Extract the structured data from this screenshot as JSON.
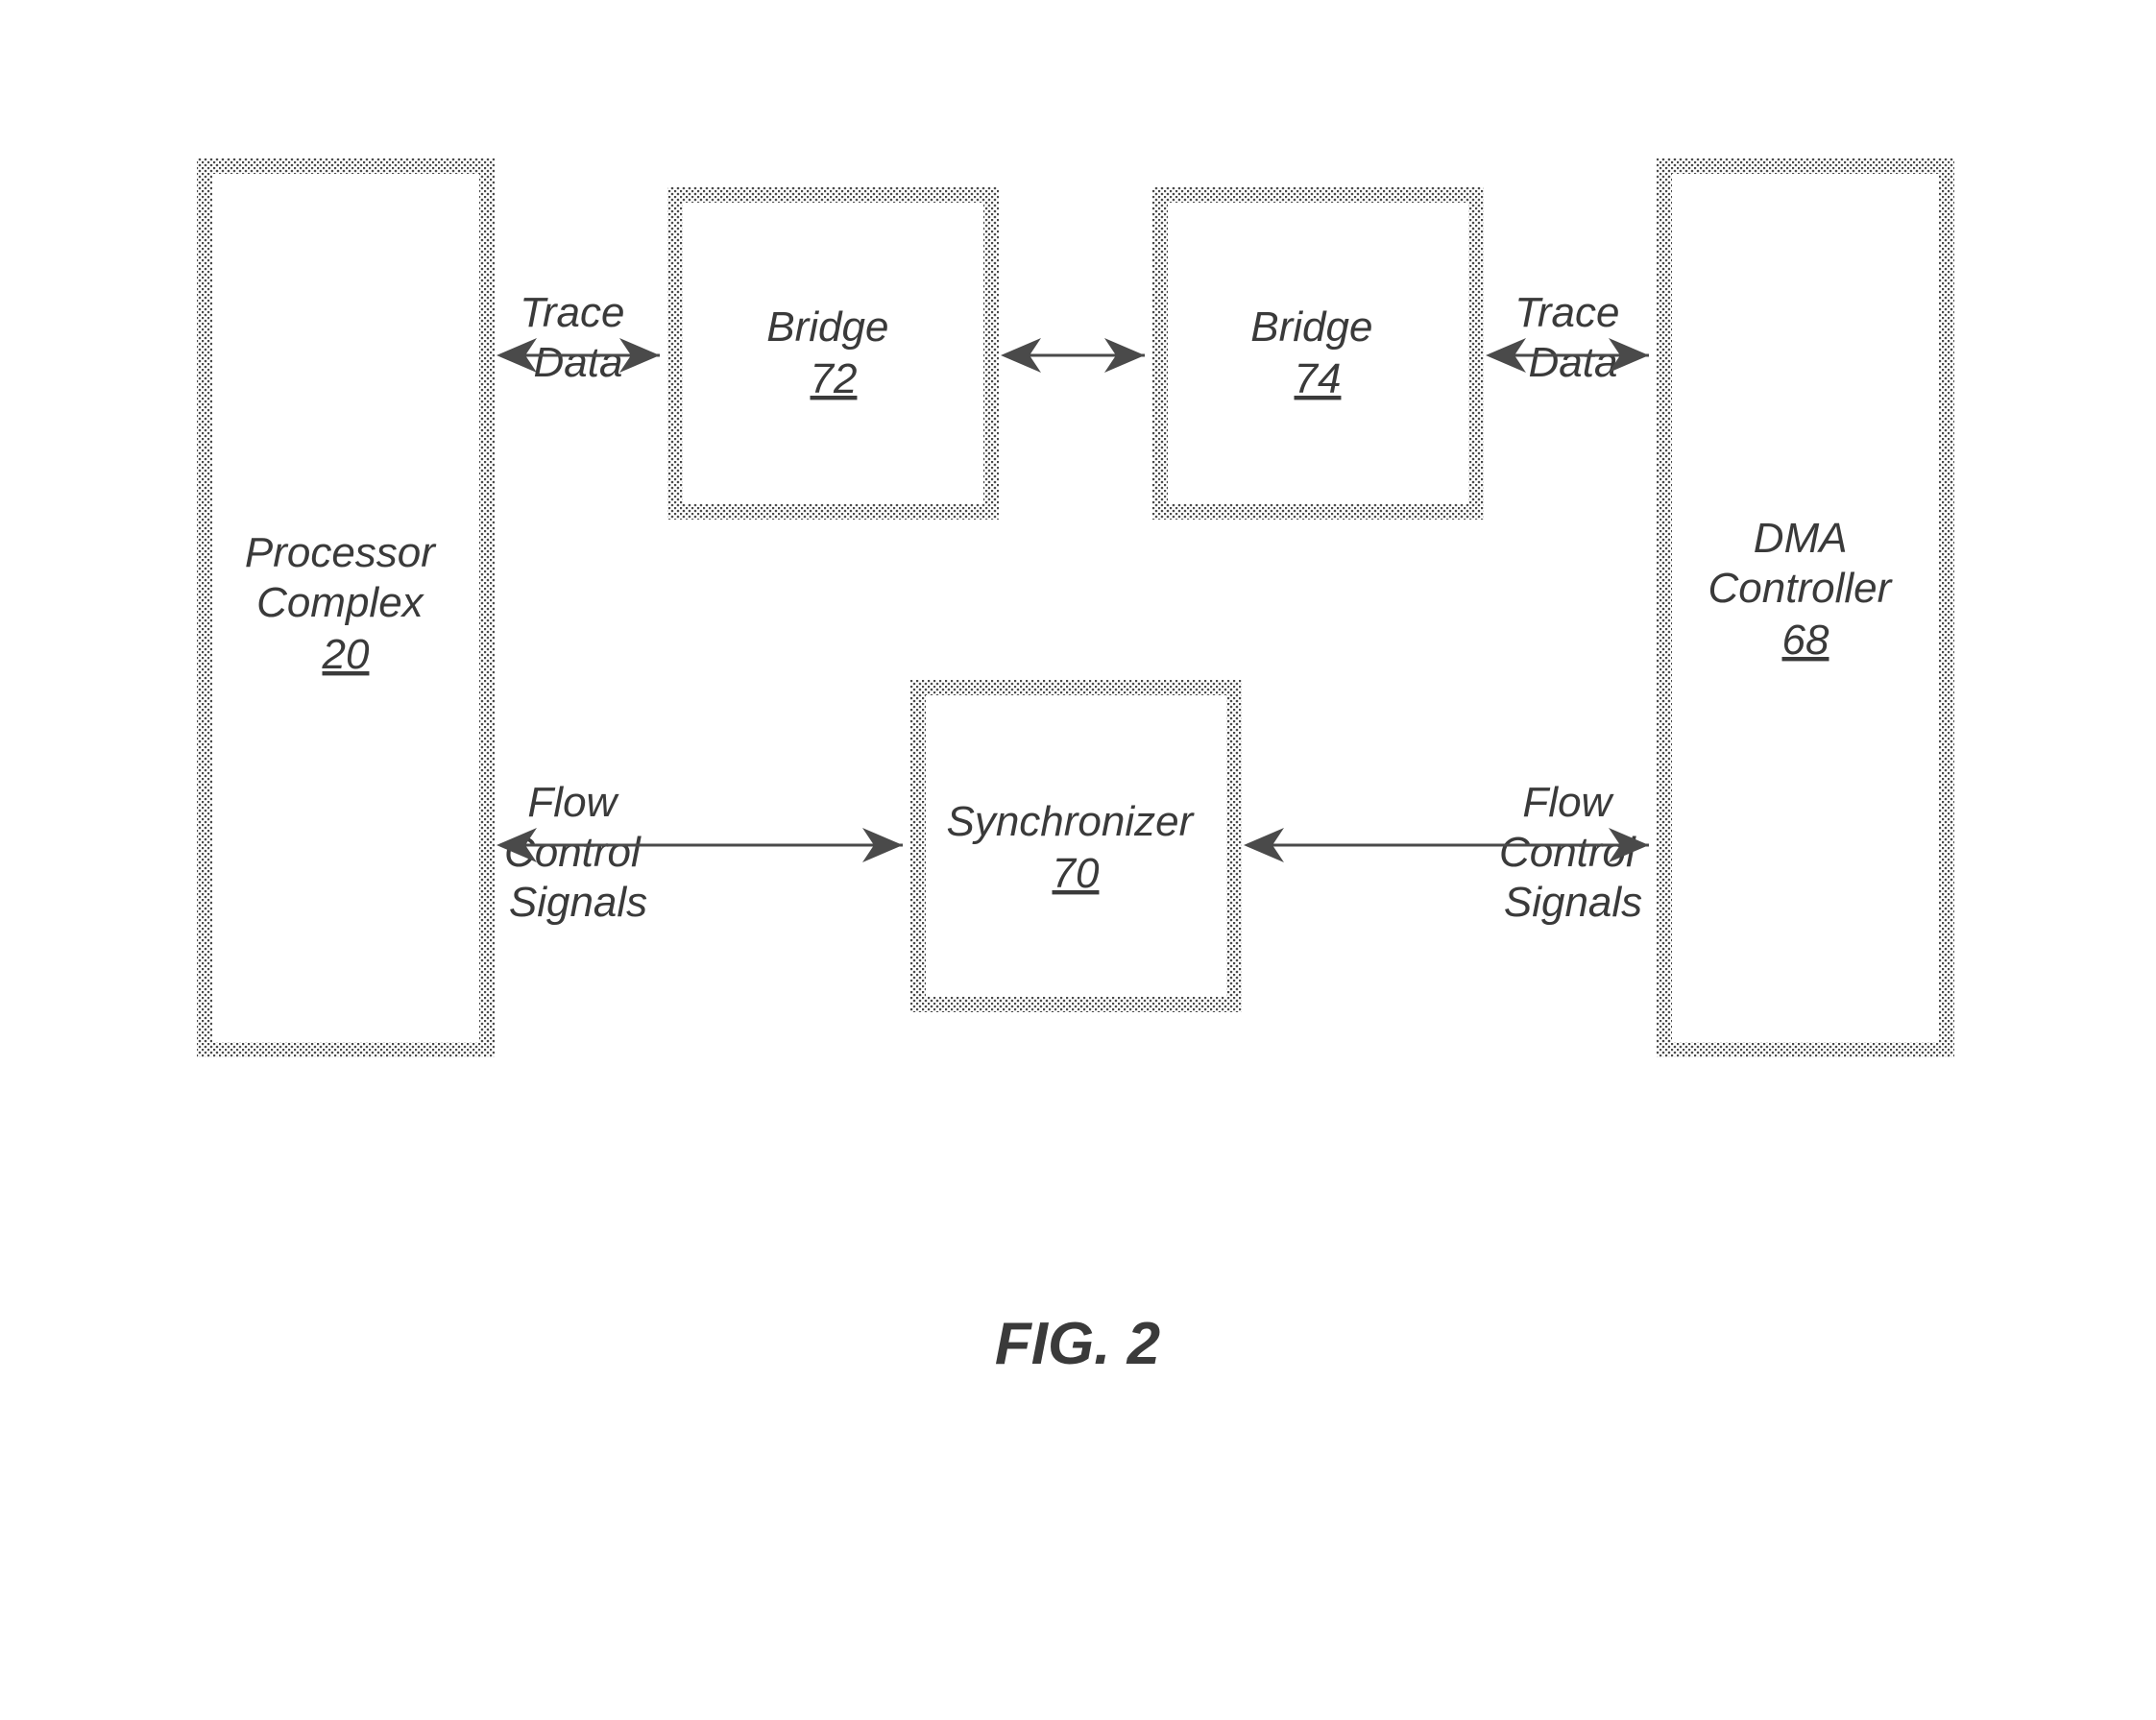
{
  "blocks": {
    "processor_complex": {
      "title": "Processor\nComplex",
      "ref": "20"
    },
    "bridge_left": {
      "title": "Bridge",
      "ref": "72"
    },
    "bridge_right": {
      "title": "Bridge",
      "ref": "74"
    },
    "dma_controller": {
      "title": "DMA\nController",
      "ref": "68"
    },
    "synchronizer": {
      "title": "Synchronizer",
      "ref": "70"
    }
  },
  "signal_labels": {
    "trace_data_left": "Trace\nData",
    "trace_data_right": "Trace\nData",
    "flow_control_left": "Flow\nControl\nSignals",
    "flow_control_right": "Flow\nControl\nSignals"
  },
  "caption": "FIG. 2"
}
